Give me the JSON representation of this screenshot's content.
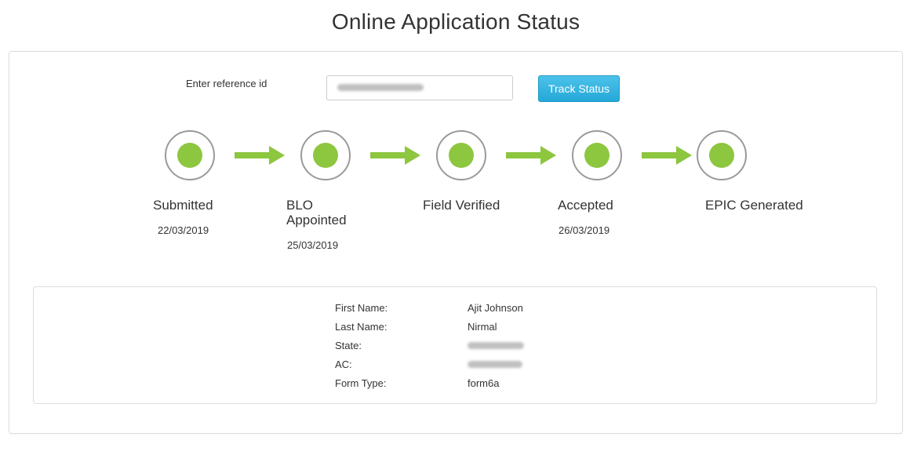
{
  "page_title": "Online Application Status",
  "search": {
    "label": "Enter reference id",
    "value": "",
    "button_label": "Track Status"
  },
  "colors": {
    "accent_green": "#8dc63f",
    "button_blue": "#25a8d8",
    "circle_border": "#9a9a9a"
  },
  "steps": [
    {
      "label": "Submitted",
      "date": "22/03/2019",
      "icon": "completed-dot-icon"
    },
    {
      "label": "BLO Appointed",
      "date": "25/03/2019",
      "icon": "completed-dot-icon"
    },
    {
      "label": "Field Verified",
      "date": "",
      "icon": "completed-dot-icon"
    },
    {
      "label": "Accepted",
      "date": "26/03/2019",
      "icon": "completed-dot-icon"
    },
    {
      "label": "EPIC Generated",
      "date": "",
      "icon": "completed-dot-icon"
    }
  ],
  "details": [
    {
      "label": "First Name:",
      "value": "Ajit Johnson"
    },
    {
      "label": "Last Name:",
      "value": "Nirmal"
    },
    {
      "label": "State:",
      "value": ""
    },
    {
      "label": "AC:",
      "value": ""
    },
    {
      "label": "Form Type:",
      "value": "form6a"
    }
  ]
}
